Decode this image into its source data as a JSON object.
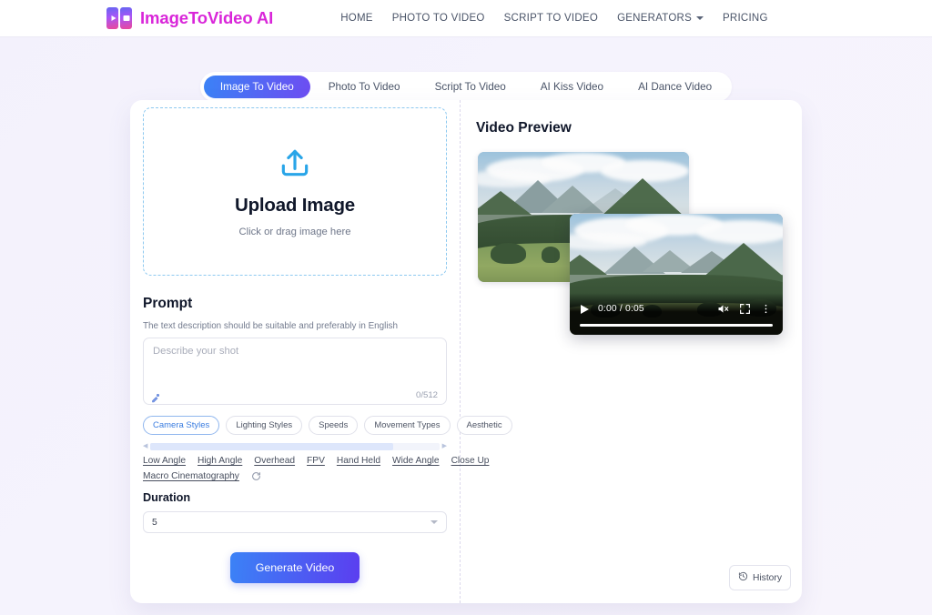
{
  "header": {
    "brand": "ImageToVideo AI",
    "logo_icon_1": "play-tile-icon",
    "logo_icon_2": "frame-tile-icon",
    "nav": [
      {
        "label": "HOME",
        "caret": false
      },
      {
        "label": "PHOTO TO VIDEO",
        "caret": false
      },
      {
        "label": "SCRIPT TO VIDEO",
        "caret": false
      },
      {
        "label": "GENERATORS",
        "caret": true
      },
      {
        "label": "PRICING",
        "caret": false
      }
    ]
  },
  "tabs": [
    {
      "label": "Image To Video",
      "active": true
    },
    {
      "label": "Photo To Video",
      "active": false
    },
    {
      "label": "Script To Video",
      "active": false
    },
    {
      "label": "AI Kiss Video",
      "active": false
    },
    {
      "label": "AI Dance Video",
      "active": false
    }
  ],
  "upload": {
    "icon": "upload-arrow-icon",
    "title": "Upload Image",
    "subtitle": "Click or drag image here"
  },
  "prompt": {
    "title": "Prompt",
    "hint": "The text description should be suitable and preferably in English",
    "placeholder": "Describe your shot",
    "value": "",
    "counter": "0/512",
    "tool_icon": "magic-wand-icon"
  },
  "style_chips": [
    {
      "label": "Camera Styles",
      "active": true
    },
    {
      "label": "Lighting Styles",
      "active": false
    },
    {
      "label": "Speeds",
      "active": false
    },
    {
      "label": "Movement Types",
      "active": false
    },
    {
      "label": "Aesthetic",
      "active": false
    }
  ],
  "scrollbar": {
    "left_arrow": "chevron-left-icon",
    "right_arrow": "chevron-right-icon"
  },
  "tags_row_1": [
    "Low Angle",
    "High Angle",
    "Overhead",
    "FPV",
    "Hand Held",
    "Wide Angle",
    "Close Up"
  ],
  "tags_row_2": [
    "Macro Cinematography"
  ],
  "refresh_icon": "refresh-icon",
  "duration": {
    "label": "Duration",
    "value": "5",
    "caret_icon": "chevron-down-icon"
  },
  "generate": {
    "label": "Generate Video"
  },
  "preview": {
    "title": "Video Preview",
    "player": {
      "play_icon": "play-icon",
      "time": "0:00 / 0:05",
      "mute_icon": "volume-muted-icon",
      "fullscreen_icon": "fullscreen-icon",
      "more_icon": "more-vertical-icon"
    },
    "history": {
      "label": "History",
      "icon": "history-clock-icon"
    }
  },
  "colors": {
    "brand": "#d926d9",
    "accent_start": "#3b82f6",
    "accent_end": "#5b3ef0",
    "dropzone_border": "#8ec9f0",
    "page_background": "#f4f2fd"
  }
}
